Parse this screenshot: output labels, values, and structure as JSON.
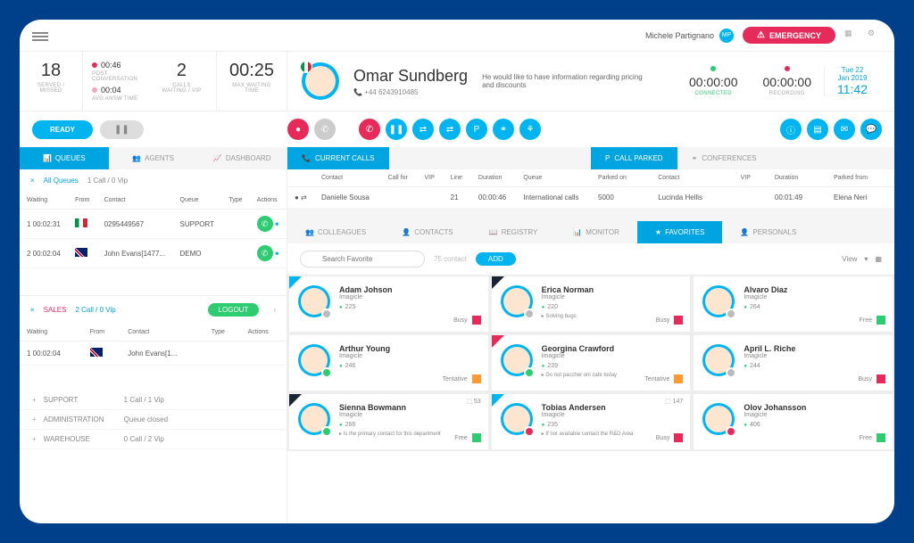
{
  "header": {
    "username": "Michele Partignano",
    "emergency": "EMERGENCY"
  },
  "stats": {
    "waiting": "18",
    "waiting_lbl": "SERVED / MISSED",
    "time1": "00:46",
    "time1_lbl": "POST CONVERSATION",
    "time2": "00:04",
    "time2_lbl": "AVG ANSW TIME",
    "calls": "2",
    "calls_lbl": "CALLS WAITING / VIP",
    "maxwait": "00:25",
    "maxwait_lbl": "MAX WAITING TIME"
  },
  "caller": {
    "name": "Omar Sundberg",
    "phone": "+44 6243910485",
    "note": "He would like to have information regarding pricing and discounts",
    "connected": "00:00:00",
    "connected_lbl": "CONNECTED",
    "recording": "00:00:00",
    "recording_lbl": "RECORDING"
  },
  "date": {
    "day": "Tue 22",
    "month": "Jan 2019",
    "time": "11:42"
  },
  "ready_btn": "READY",
  "left_tabs": {
    "queues": "QUEUES",
    "agents": "AGENTS",
    "dashboard": "DASHBOARD"
  },
  "allq": {
    "x": "×",
    "name": "All Queues",
    "stat": "1 Call / 0 Vip",
    "headers": {
      "waiting": "Waiting",
      "from": "From",
      "contact": "Contact",
      "queue": "Queue",
      "type": "Type",
      "actions": "Actions"
    },
    "rows": [
      {
        "n": "1",
        "wait": "00:02:31",
        "flag": "it",
        "contact": "0295449567",
        "queue": "SUPPORT"
      },
      {
        "n": "2",
        "wait": "00:02:04",
        "flag": "uk",
        "contact": "John Evans[1477...",
        "queue": "DEMO"
      }
    ]
  },
  "salesq": {
    "x": "×",
    "name": "SALES",
    "stat": "2 Call / 0 Vip",
    "logout": "LOGOUT",
    "headers": {
      "waiting": "Waiting",
      "from": "From",
      "contact": "Contact",
      "type": "Type",
      "actions": "Actions"
    },
    "rows": [
      {
        "n": "1",
        "wait": "00:02:04",
        "flag": "uk",
        "contact": "John Evans[1..."
      }
    ]
  },
  "ext_rows": [
    {
      "lbl": "SUPPORT",
      "stat": "1 Call / 1 Vip"
    },
    {
      "lbl": "ADMINISTRATION",
      "stat": "Queue closed"
    },
    {
      "lbl": "WAREHOUSE",
      "stat": "0 Call / 2 Vip"
    }
  ],
  "current_calls": {
    "tab": "CURRENT CALLS",
    "headers": {
      "contact": "Contact",
      "callfor": "Call for",
      "vip": "VIP",
      "line": "Line",
      "duration": "Duration",
      "queue": "Queue"
    },
    "rows": [
      {
        "contact": "Danielle Sousa",
        "line": "21",
        "duration": "00:00:46",
        "queue": "International calls"
      }
    ]
  },
  "parked": {
    "tab": "CALL PARKED",
    "conf_tab": "CONFERENCES",
    "headers": {
      "parkedon": "Parked on",
      "contact": "Contact",
      "vip": "VIP",
      "duration": "Duration",
      "parkedfrom": "Parked from"
    },
    "rows": [
      {
        "parkedon": "5000",
        "contact": "Lucinda Hellis",
        "duration": "00:01:49",
        "from": "Elena Neri"
      }
    ]
  },
  "bottom_tabs": {
    "colleagues": "COLLEAGUES",
    "contacts": "CONTACTS",
    "registry": "REGISTRY",
    "monitor": "MONITOR",
    "favorites": "FAVORITES",
    "personals": "PERSONALS"
  },
  "search": {
    "placeholder": "Search Favorite",
    "count": "75 contact",
    "add": "ADD",
    "view": "View"
  },
  "favorites": [
    {
      "name": "Adam Johson",
      "org": "Imagicle",
      "ext": "225",
      "status": "Busy",
      "sq": "red",
      "presence": "gray",
      "corner": "teal"
    },
    {
      "name": "Erica Norman",
      "org": "Imagicle",
      "ext": "220",
      "note": "Solving bugs",
      "status": "Busy",
      "sq": "red",
      "presence": "gray",
      "corner": "dark"
    },
    {
      "name": "Alvaro Diaz",
      "org": "Imagicle",
      "ext": "264",
      "status": "Free",
      "sq": "green",
      "presence": "gray",
      "corner": ""
    },
    {
      "name": "Arthur Young",
      "org": "Imagicle",
      "ext": "246",
      "status": "Tentative",
      "sq": "orange",
      "presence": "green",
      "corner": ""
    },
    {
      "name": "Georgina Crawford",
      "org": "Imagicle",
      "ext": "239",
      "note": "Do not paccher oni cafe today",
      "status": "Tentative",
      "sq": "orange",
      "presence": "green",
      "corner": "red"
    },
    {
      "name": "April L. Riche",
      "org": "Imagicle",
      "ext": "244",
      "status": "Busy",
      "sq": "red",
      "presence": "gray",
      "corner": ""
    },
    {
      "name": "Sienna Bowmann",
      "org": "Imagicle",
      "ext": "266",
      "note": "Is the primary contact for this department",
      "status": "Free",
      "sq": "green",
      "presence": "green",
      "corner": "dark",
      "badge": "53"
    },
    {
      "name": "Tobias Andersen",
      "org": "Imagicle",
      "ext": "235",
      "note": "If not available contact the R&D Area",
      "status": "Busy",
      "sq": "red",
      "presence": "red",
      "corner": "teal",
      "badge": "147"
    },
    {
      "name": "Olov Johansson",
      "org": "Imagicle",
      "ext": "406",
      "status": "Free",
      "sq": "green",
      "presence": "red",
      "corner": ""
    }
  ]
}
